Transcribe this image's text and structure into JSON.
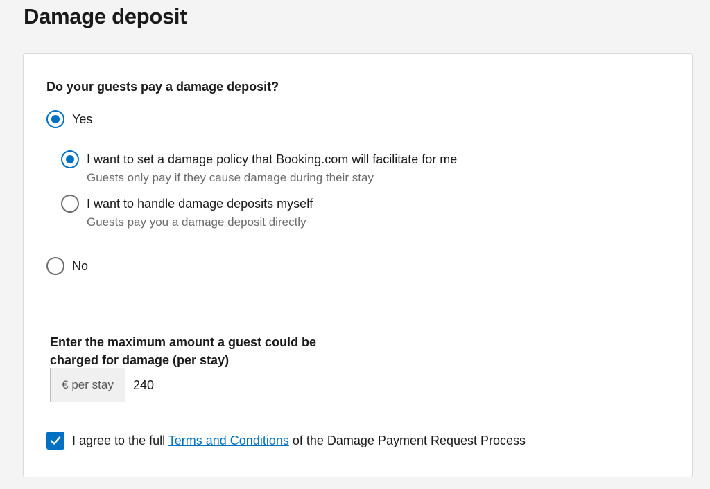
{
  "page": {
    "title": "Damage deposit"
  },
  "question": {
    "text": "Do your guests pay a damage deposit?"
  },
  "options": {
    "yes": {
      "label": "Yes",
      "checked": true
    },
    "facilitate": {
      "label": "I want to set a damage policy that Booking.com will facilitate for me",
      "sublabel": "Guests only pay if they cause damage during their stay",
      "checked": true
    },
    "myself": {
      "label": "I want to handle damage deposits myself",
      "sublabel": "Guests pay you a damage deposit directly",
      "checked": false
    },
    "no": {
      "label": "No",
      "checked": false
    }
  },
  "amount": {
    "label": "Enter the maximum amount a guest could be charged for damage (per stay)",
    "addon": "€ per stay",
    "value": "240"
  },
  "agreement": {
    "checked": true,
    "prefix": "I agree to the full ",
    "link": "Terms and Conditions",
    "suffix": " of the Damage Payment Request Process"
  },
  "colors": {
    "accent": "#0071c2",
    "muted_text": "#6b6b6b",
    "border": "#dadada",
    "background": "#f4f4f4"
  },
  "icons": {
    "checkbox": "checkmark-icon"
  }
}
